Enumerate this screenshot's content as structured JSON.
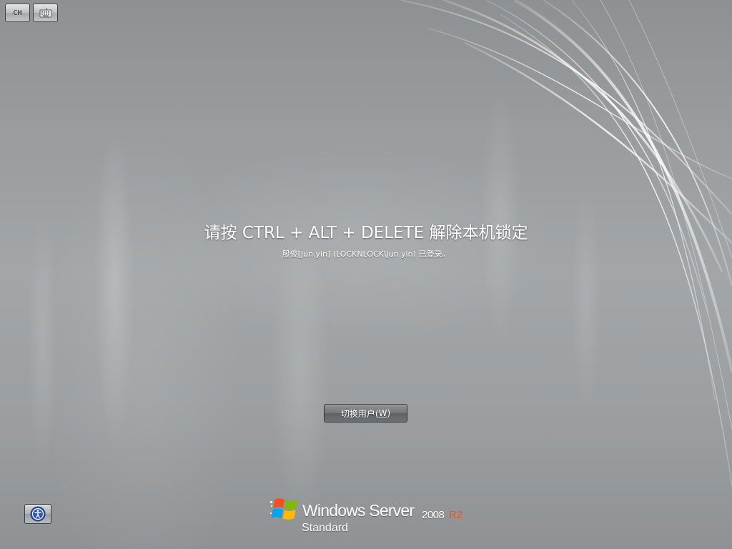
{
  "toolbar": {
    "language_label": "CH",
    "keyboard_icon": "keyboard-icon"
  },
  "lock": {
    "prompt": "请按 CTRL + ALT + DELETE 解除本机锁定",
    "logged_on": "殷俊[jun.yin] (LOCKNLOCK\\jun.yin) 已登录。"
  },
  "switch_user": {
    "label": "切换用户(",
    "accelerator": "W",
    "label_end": ")"
  },
  "ease_of_access": {
    "icon": "ease-of-access-icon"
  },
  "branding": {
    "product": "Windows Server",
    "version": "2008",
    "release": "R2",
    "edition": "Standard",
    "accent": "#e8581e"
  }
}
